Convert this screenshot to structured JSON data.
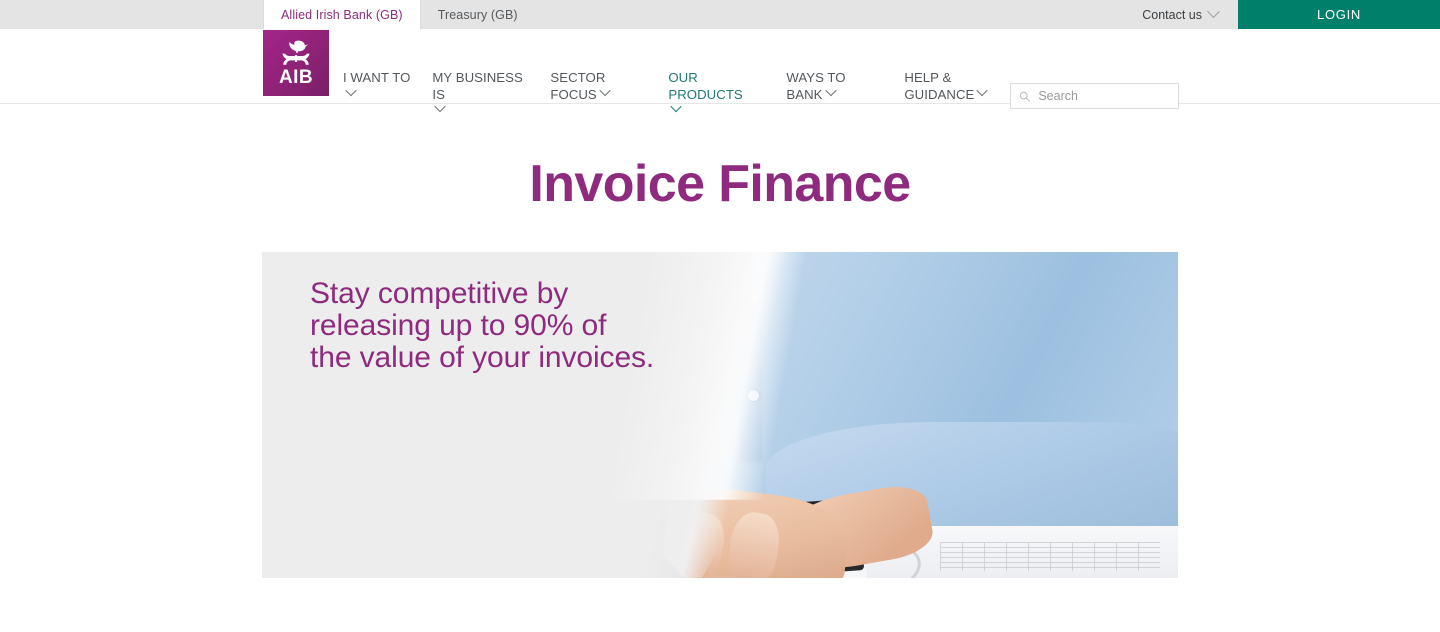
{
  "topbar": {
    "site_tabs": [
      {
        "label": "Allied Irish Bank (GB)",
        "active": true
      },
      {
        "label": "Treasury (GB)",
        "active": false
      }
    ],
    "contact_label": "Contact us",
    "login_label": "LOGIN",
    "login_color": "#00806a",
    "active_tab_color": "#8e2b7e"
  },
  "header": {
    "logo_text": "AIB",
    "logo_alt": "AIB ark and bird logo",
    "nav": [
      {
        "label": "I WANT TO",
        "has_caret": true,
        "active": false
      },
      {
        "label": "MY BUSINESS IS",
        "has_caret": true,
        "active": false
      },
      {
        "label": "SECTOR FOCUS",
        "has_caret": true,
        "active": false
      },
      {
        "label": "OUR PRODUCTS",
        "has_caret": true,
        "active": true
      },
      {
        "label": "WAYS TO BANK",
        "has_caret": true,
        "active": false
      },
      {
        "label": "HELP & GUIDANCE",
        "has_caret": true,
        "active": false
      }
    ],
    "active_nav_color": "#1f7a72",
    "search": {
      "placeholder": "Search",
      "value": "",
      "icon": "search-icon"
    }
  },
  "main": {
    "page_title": "Invoice Finance",
    "page_title_color": "#8e2b7e",
    "hero": {
      "headline_line1": "Stay competitive by",
      "headline_line2": "releasing up to 90% of",
      "headline_line3": "the value of your invoices.",
      "headline_color": "#8e2b7e",
      "image_alt": "Man in light blue shirt using a calculator at a desk with a laptop, mouse and paperwork"
    }
  }
}
